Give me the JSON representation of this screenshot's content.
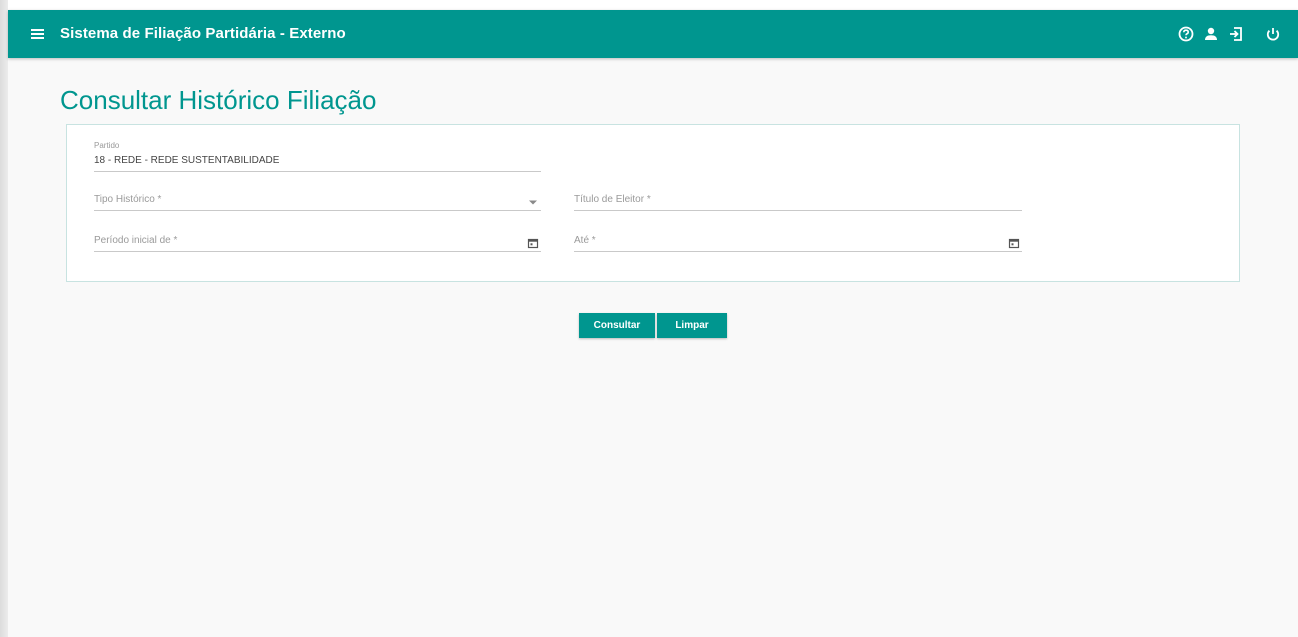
{
  "toolbar": {
    "title": "Sistema de Filiação Partidária - Externo",
    "menu_icon": "hamburger-menu-icon",
    "icons": [
      "help-icon",
      "user-icon",
      "login-icon",
      "power-icon"
    ],
    "color": "#00968f"
  },
  "page": {
    "title": "Consultar Histórico Filiação"
  },
  "form": {
    "partido": {
      "label": "Partido",
      "value": "18 - REDE - REDE SUSTENTABILIDADE"
    },
    "tipo_historico": {
      "placeholder": "Tipo Histórico *"
    },
    "titulo_eleitor": {
      "placeholder": "Título de Eleitor *"
    },
    "periodo_inicial": {
      "placeholder": "Período inicial de *"
    },
    "ate": {
      "placeholder": "Até *"
    }
  },
  "actions": {
    "consultar": "Consultar",
    "limpar": "Limpar"
  }
}
